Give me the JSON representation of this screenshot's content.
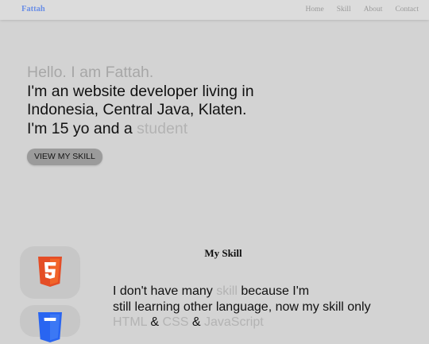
{
  "navbar": {
    "brand": "Fattah",
    "links": [
      "Home",
      "Skill",
      "About",
      "Contact"
    ]
  },
  "hero": {
    "greeting": "Hello. I am Fattah.",
    "line1": "I'm an website developer living in",
    "line2": "Indonesia, Central Java, Klaten.",
    "line3_prefix": "I'm 15 yo and a ",
    "line3_accent": "student",
    "button_label": "VIEW MY SKILL"
  },
  "skills": {
    "title": "My Skill",
    "desc_prefix": "I don't have many ",
    "desc_accent": "skill",
    "desc_suffix": " because I'm",
    "desc_line2": "still learning other language, now my skill only",
    "skill_html": "HTML",
    "sep1": " & ",
    "skill_css": "CSS",
    "sep2": " & ",
    "skill_js": "JavaScript",
    "icons": [
      "html5-icon",
      "css3-icon"
    ]
  },
  "colors": {
    "background": "#d3d3d3",
    "navbar": "#dcdcdc",
    "brand": "#6b8fe6",
    "muted_text": "#b3b3b3",
    "button": "#9b9b9b",
    "html5": "#e44d26",
    "css3": "#2965f1"
  }
}
